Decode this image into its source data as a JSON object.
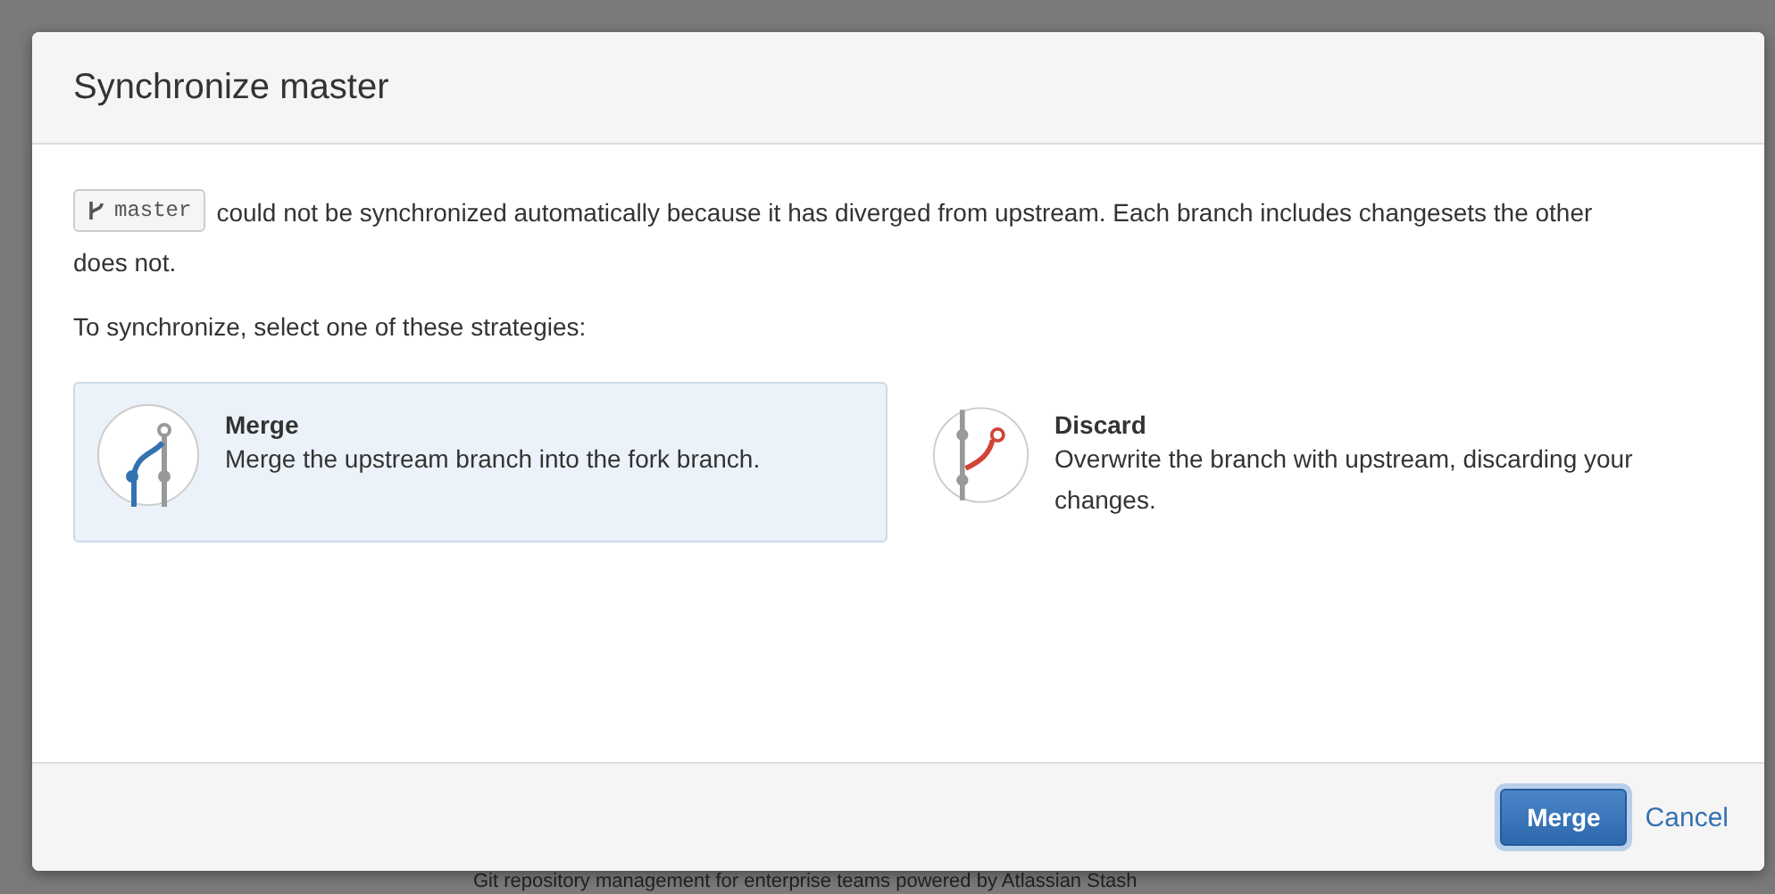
{
  "dialog": {
    "title": "Synchronize master",
    "branch": "master",
    "message": "could not be synchronized automatically because it has diverged from upstream. Each branch includes changesets the other does not.",
    "prompt": "To synchronize, select one of these strategies:",
    "strategies": [
      {
        "kind": "merge",
        "title": "Merge",
        "description": "Merge the upstream branch into the fork branch.",
        "selected": true
      },
      {
        "kind": "discard",
        "title": "Discard",
        "description": "Overwrite the branch with upstream, discarding your changes.",
        "selected": false
      }
    ],
    "primary_button": "Merge",
    "cancel_link": "Cancel"
  },
  "page_footer": "Git repository management for enterprise teams powered by Atlassian Stash"
}
